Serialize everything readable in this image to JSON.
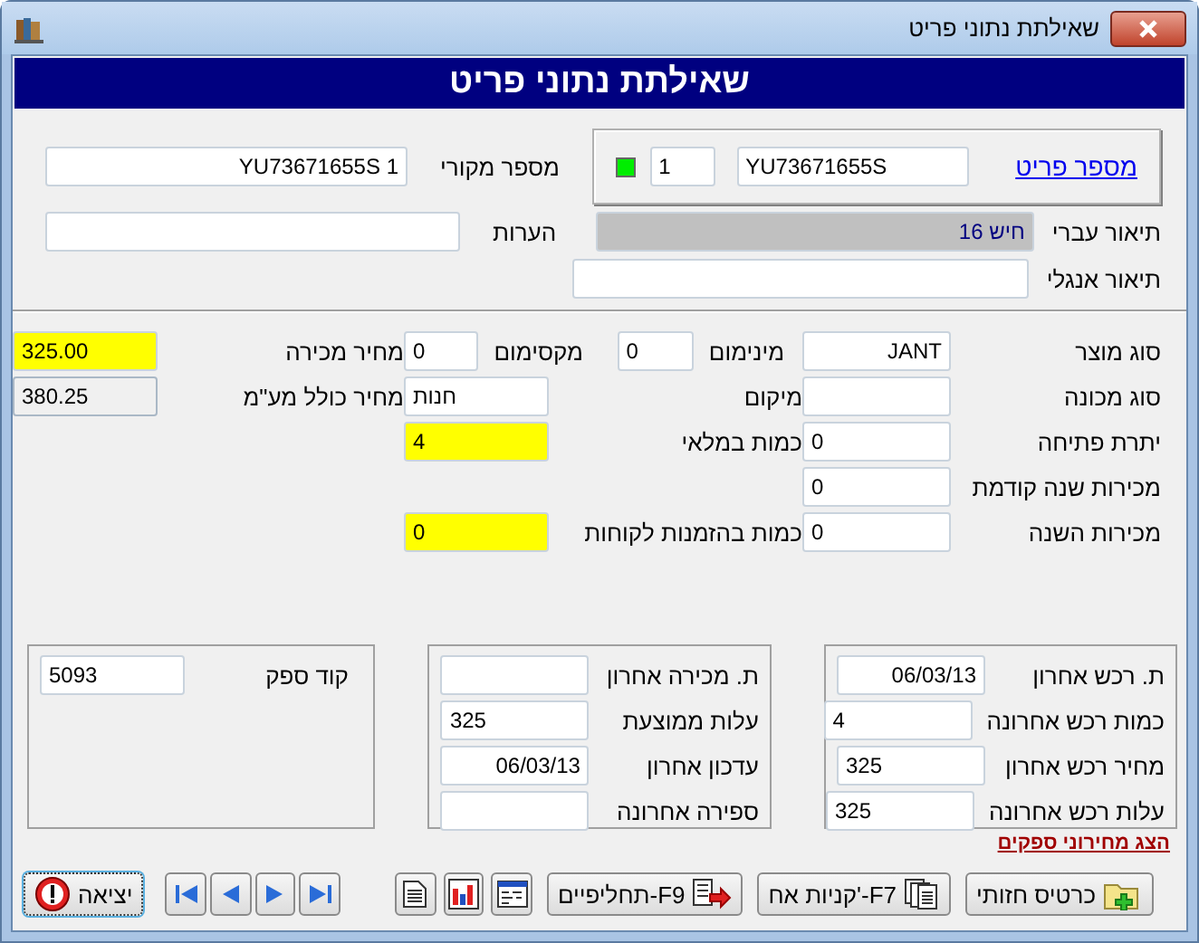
{
  "window": {
    "title": "שאילתת נתוני פריט"
  },
  "header": {
    "title": "שאילתת נתוני פריט"
  },
  "item_panel": {
    "link": "מספר פריט",
    "number": "YU73671655S",
    "sub_number": "1"
  },
  "original_number": {
    "label": "מספר מקורי",
    "value": "YU73671655S 1"
  },
  "hebrew_description": {
    "label": "תיאור עברי",
    "value": "חיש 16"
  },
  "remarks": {
    "label": "הערות"
  },
  "english_description": {
    "label": "תיאור אנגלי"
  },
  "main_rows": [
    [
      {
        "label": "סוג מוצר",
        "value": "JANT",
        "highlighted": false,
        "readonly": false
      },
      {
        "label": "מינימום",
        "value": "0",
        "highlighted": false,
        "readonly": false
      },
      {
        "label": "מקסימום",
        "value": "0",
        "highlighted": false,
        "readonly": false
      },
      {
        "label": "מחיר מכירה",
        "value": "325.00",
        "highlighted": true,
        "readonly": false
      }
    ],
    [
      {
        "label": "סוג מכונה",
        "highlighted": false,
        "readonly": false
      },
      {
        "label": "מיקום",
        "value": "חנות",
        "highlighted": false,
        "readonly": false
      },
      {
        "label": "מחיר כולל מע\"מ",
        "value": "380.25",
        "highlighted": false,
        "readonly": true
      }
    ],
    [
      {
        "label": "יתרת פתיחה",
        "value": "0",
        "highlighted": false,
        "readonly": false
      },
      {
        "label": "כמות במלאי",
        "value": "4",
        "highlighted": true,
        "readonly": false
      }
    ],
    [
      {
        "label": "מכירות שנה קודמת",
        "value": "0",
        "highlighted": false,
        "readonly": false
      }
    ],
    [
      {
        "label": "מכירות השנה",
        "value": "0",
        "highlighted": false,
        "readonly": false
      },
      {
        "label": "כמות בהזמנות לקוחות",
        "value": "0",
        "highlighted": true,
        "readonly": false
      }
    ]
  ],
  "purchase_box": [
    {
      "label": "ת. רכש אחרון",
      "value": "06/03/13"
    },
    {
      "label": "כמות רכש אחרונה",
      "value": "4"
    },
    {
      "label": "מחיר רכש אחרון",
      "value": "325"
    },
    {
      "label": "עלות רכש אחרונה",
      "value": "325"
    }
  ],
  "sales_box": [
    {
      "label": "ת. מכירה אחרון"
    },
    {
      "label": "עלות ממוצעת",
      "value": "325"
    },
    {
      "label": "עדכון אחרון",
      "value": "06/03/13"
    },
    {
      "label": "ספירה אחרונה"
    }
  ],
  "supplier_box": [
    {
      "label": "קוד ספק",
      "value": "5093"
    }
  ],
  "supplier_prices_link": "הצג מחירוני ספקים",
  "toolbar": [
    {
      "kind": "card",
      "label": "כרטיס חזותי"
    },
    {
      "kind": "purchases",
      "label": "קניות אח'-F7"
    },
    {
      "kind": "substitutes",
      "label": "תחליפיים-F9"
    },
    {
      "kind": "window"
    },
    {
      "kind": "chart"
    },
    {
      "kind": "document"
    },
    {
      "kind": "last"
    },
    {
      "kind": "next"
    },
    {
      "kind": "previous"
    },
    {
      "kind": "first"
    },
    {
      "kind": "exit",
      "label": "יציאה"
    }
  ]
}
